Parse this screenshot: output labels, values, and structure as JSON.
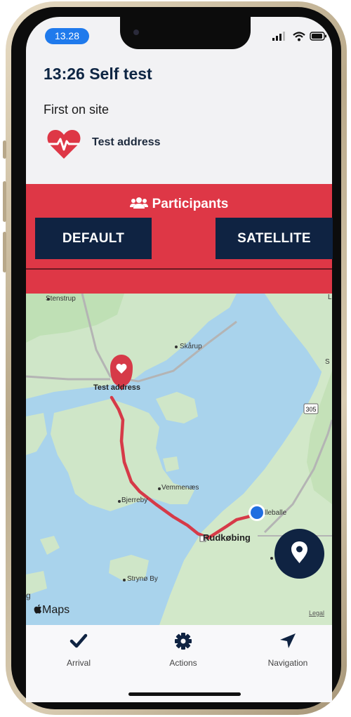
{
  "status_bar": {
    "time": "13.28"
  },
  "header": {
    "title": "13:26 Self test",
    "subtitle": "First on site",
    "address": "Test address"
  },
  "panel": {
    "participants_label": "Participants",
    "default_button": "DEFAULT",
    "satellite_button": "SATELLITE"
  },
  "map": {
    "places": {
      "stenstrup": "Stenstrup",
      "lo": "Lo",
      "skarup": "Skårup",
      "s": "S",
      "test_address": "Test address",
      "road_305": "305",
      "vemmenaes": "Vemmenæs",
      "bjerreby": "Bjerreby",
      "lleballe": "lleballe",
      "rudkobing": "Rudkøbing",
      "stryno_by": "Strynø By",
      "g": "g"
    },
    "attribution": "Maps",
    "legal": "Legal"
  },
  "nav": {
    "arrival": "Arrival",
    "actions": "Actions",
    "navigation": "Navigation"
  },
  "colors": {
    "accent_red": "#de3746",
    "navy": "#0f2342",
    "status_blue": "#1f7aec",
    "route": "#d63a48"
  }
}
